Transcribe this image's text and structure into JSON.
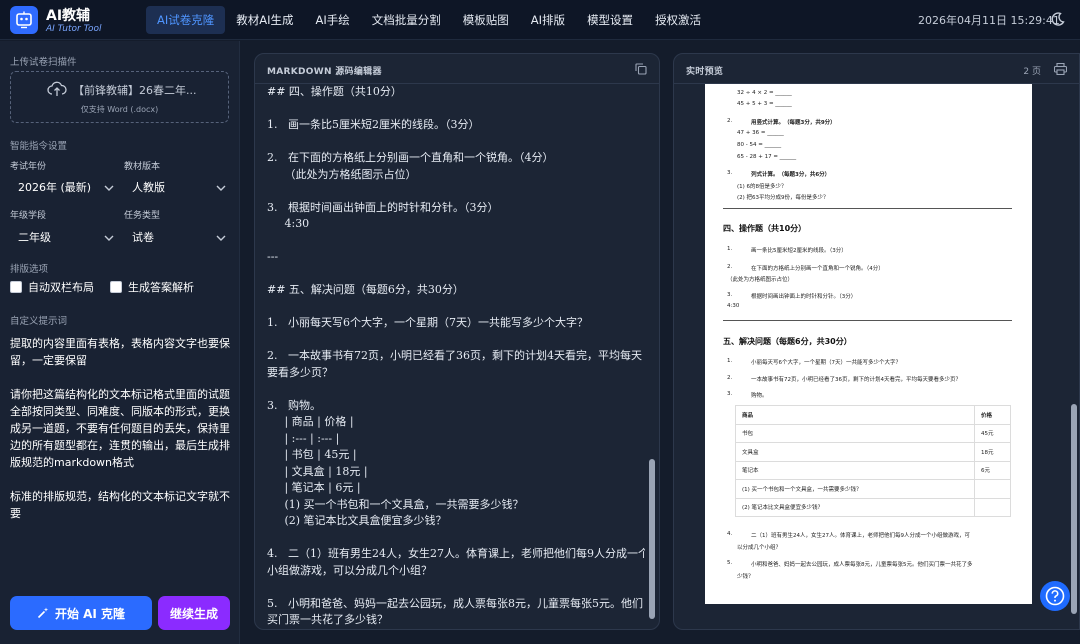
{
  "brand": {
    "title": "AI教辅",
    "subtitle": "AI Tutor Tool"
  },
  "nav": {
    "items": [
      "AI试卷克隆",
      "教材AI生成",
      "AI手绘",
      "文档批量分割",
      "模板贴图",
      "AI排版",
      "模型设置",
      "授权激活"
    ],
    "active_index": 0
  },
  "datetime": "2026年04月11日 15:29:41",
  "colors": {
    "accent": "#2b6bff",
    "purple": "#8b2bff",
    "active_nav_text": "#4f95ff"
  },
  "sidebar": {
    "upload_label": "上传试卷扫描件",
    "upload_file": "【前锋教辅】26春二年...",
    "upload_hint": "仅支持 Word (.docx)",
    "instr_label": "智能指令设置",
    "year_label": "考试年份",
    "year_value": "2026年 (最新)",
    "edition_label": "教材版本",
    "edition_value": "人教版",
    "grade_label": "年级学段",
    "grade_value": "二年级",
    "task_label": "任务类型",
    "task_value": "试卷",
    "layout_label": "排版选项",
    "opt_double": "自动双栏布局",
    "opt_answer": "生成答案解析",
    "prompt_label": "自定义提示词",
    "prompt_p1": "提取的内容里面有表格，表格内容文字也要保留，一定要保留",
    "prompt_p2": "请你把这篇结构化的文本标记格式里面的试题全部按同类型、同难度、同版本的形式，更换成另一道题，不要有任何题目的丢失，保持里边的所有题型都在，连贯的输出，最后生成排版规范的markdown格式",
    "prompt_p3": "标准的排版规范，结构化的文本标记文字就不要",
    "btn_start": "开始 AI 克隆",
    "btn_continue": "继续生成"
  },
  "editor": {
    "title": "MARKDOWN 源码编辑器",
    "lines": [
      "## 四、操作题（共10分）",
      "",
      "1.   画一条比5厘米短2厘米的线段。（3分）",
      "",
      "2.   在下面的方格纸上分别画一个直角和一个锐角。（4分）",
      "     （此处为方格纸图示占位）",
      "",
      "3.   根据时间画出钟面上的时针和分针。（3分）",
      "     4:30",
      "",
      "---",
      "",
      "## 五、解决问题（每题6分，共30分）",
      "",
      "1.   小丽每天写6个大字，一个星期（7天）一共能写多少个大字？",
      "",
      "2.   一本故事书有72页，小明已经看了36页，剩下的计划4天看完，平均每天",
      "要看多少页？",
      "",
      "3.   购物。",
      "     | 商品 | 价格 |",
      "     | :--- | :--- |",
      "     | 书包 | 45元 |",
      "     | 文具盒 | 18元 |",
      "     | 笔记本 | 6元 |",
      "     (1) 买一个书包和一个文具盒，一共需要多少钱？",
      "     (2) 笔记本比文具盒便宜多少钱？",
      "",
      "4.   二（1）班有男生24人，女生27人。体育课上，老师把他们每9人分成一个",
      "小组做游戏，可以分成几个小组？",
      "",
      "5.   小明和爸爸、妈妈一起去公园玩，成人票每张8元，儿童票每张5元。他们",
      "买门票一共花了多少钱？"
    ]
  },
  "preview": {
    "title": "实时预览",
    "pages": "2 页",
    "calc_lines": [
      "32 ÷ 4 × 2 = ______",
      "45 + 5 + 3 = ______"
    ],
    "q2_title": "用竖式计算。（每题3分，共9分）",
    "q2_lines": [
      "47 + 36 = ______",
      "80 - 54 = ______",
      "65 - 28 + 17 = ______"
    ],
    "q3_title": "列式计算。（每题3分，共6分）",
    "q3_lines": [
      "(1) 6的8倍是多少？",
      "(2) 把63平均分成9份，每份是多少？"
    ],
    "sec4_title": "四、操作题（共10分）",
    "sec4_items": [
      "画一条比5厘米短2厘米的线段。（3分）",
      "在下面的方格纸上分别画一个直角和一个锐角。（4分）",
      "根据时间画出钟面上的时针和分针。（3分）"
    ],
    "sec4_note": "（此处为方格纸图示占位）",
    "sec4_time": "4:30",
    "sec5_title": "五、解决问题（每题6分，共30分）",
    "sec5_items": [
      "小丽每天写6个大字，一个星期（7天）一共能写多少个大字？",
      "一本故事书有72页，小明已经看了36页，剩下的计划4天看完，平均每天要看多少页？",
      "购物。"
    ],
    "table": {
      "headers": [
        "商品",
        "价格"
      ],
      "rows": [
        [
          "书包",
          "45元"
        ],
        [
          "文具盒",
          "18元"
        ],
        [
          "笔记本",
          "6元"
        ],
        [
          "(1) 买一个书包和一个文具盒，一共需要多少钱？",
          ""
        ],
        [
          "(2) 笔记本比文具盒便宜多少钱？",
          ""
        ]
      ]
    },
    "sec5_q4a": "二（1）班有男生24人，女生27人。体育课上，老师把他们每9人分成一个小组做游戏，可",
    "sec5_q4b": "以分成几个小组？",
    "sec5_q5a": "小明和爸爸、妈妈一起去公园玩，成人票每张8元，儿童票每张5元。他们买门票一共花了多",
    "sec5_q5b": "少钱？"
  }
}
